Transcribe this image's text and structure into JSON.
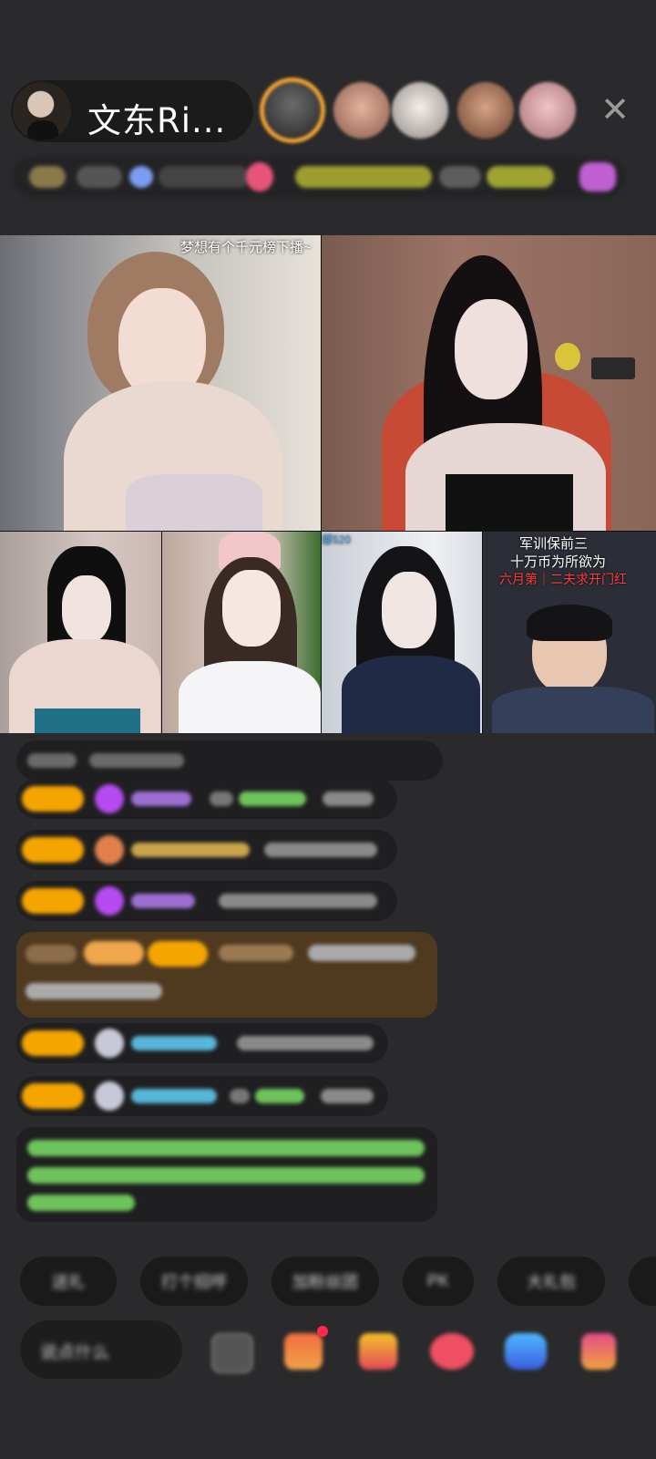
{
  "header": {
    "host_name": "文东Ri...",
    "close_icon": "close-icon",
    "viewer_avatars": [
      {
        "name": "viewer-1",
        "color": "#3a3a3a"
      },
      {
        "name": "viewer-2",
        "color": "#c98f79"
      },
      {
        "name": "viewer-3",
        "color": "#d9d2cc"
      },
      {
        "name": "viewer-4",
        "color": "#b27a5c"
      },
      {
        "name": "viewer-5",
        "color": "#d6a7a8"
      }
    ]
  },
  "grid": {
    "tile_1_caption": "梦想有个千元榜下播~",
    "tile_5_caption": "娜520",
    "tile_6_caption_line1": "军训保前三",
    "tile_6_caption_line2": "十万币为所欲为",
    "tile_6_caption_line3": "六月第｜二夫求开门红"
  },
  "colors": {
    "background": "#2a2a2c",
    "gold_badge": "#f5a500",
    "chat_green": "#6ec35b",
    "chat_blue": "#57b6d9",
    "purple_heart": "#b54af0",
    "highlight_bubble": "#5b4222"
  },
  "quick_actions": [
    "送礼",
    "打个招呼",
    "加粉丝团",
    "PK",
    "大礼包"
  ],
  "input_placeholder": "说点什么",
  "bottom_icons": [
    "emoji-icon",
    "gift-box-icon",
    "treasure-icon",
    "heart-gift-icon",
    "game-icon",
    "more-gift-icon"
  ]
}
